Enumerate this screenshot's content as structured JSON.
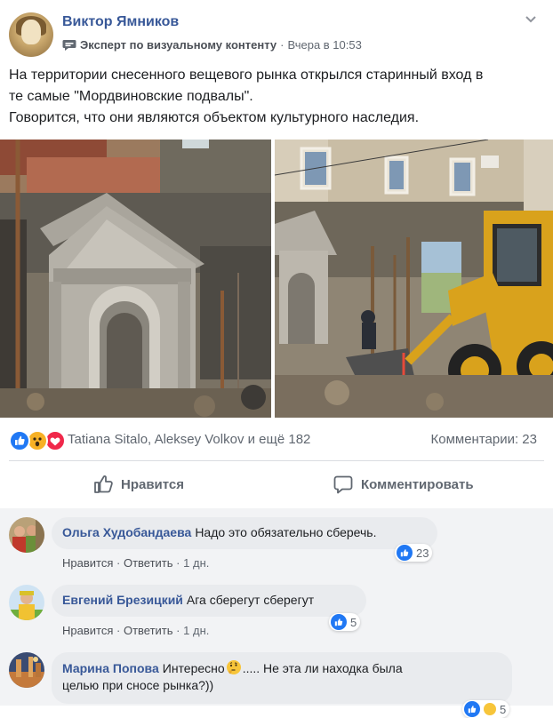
{
  "post": {
    "author": "Виктор Ямников",
    "badge": "Эксперт по визуальному контенту",
    "separator": "·",
    "time": "Вчера в 10:53",
    "lines": [
      "На территории снесенного вещевого рынка открылся старинный вход в",
      "те самые \"Мордвиновские подвалы\".",
      "Говорится, что они являются объектом культурного наследия."
    ]
  },
  "reactions": {
    "icons": [
      "like-icon",
      "wow-icon",
      "love-icon"
    ],
    "names": "Tatiana Sitalo, Aleksey Volkov и ещё 182",
    "comments": "Комментарии: 23"
  },
  "actions": {
    "like": "Нравится",
    "comment": "Комментировать"
  },
  "comments": [
    {
      "name": "Ольга Худобандаева",
      "text": "Надо это обязательно сберечь.",
      "like": "Нравится",
      "reply": "Ответить",
      "dot": "·",
      "time": "1 дн.",
      "likes": "23"
    },
    {
      "name": "Евгений Брезицкий",
      "text": "Ага сберегут сберегут",
      "like": "Нравится",
      "reply": "Ответить",
      "dot": "·",
      "time": "1 дн.",
      "likes": "5"
    },
    {
      "name": "Марина Попова",
      "text_a": "Интересно",
      "text_b": "..... Не эта ли находка была",
      "text_c": "целью при сносе рынка?))",
      "reaction_icons": [
        "like-icon",
        "thinking-icon"
      ],
      "likes": "5"
    }
  ],
  "colors": {
    "link": "#385898",
    "meta": "#606770",
    "like_blue": "#2078f4",
    "love_red": "#f0284a",
    "wow_yellow": "#f7b125",
    "comment_bg": "#f2f3f5",
    "bubble_bg": "#e9ebee"
  }
}
